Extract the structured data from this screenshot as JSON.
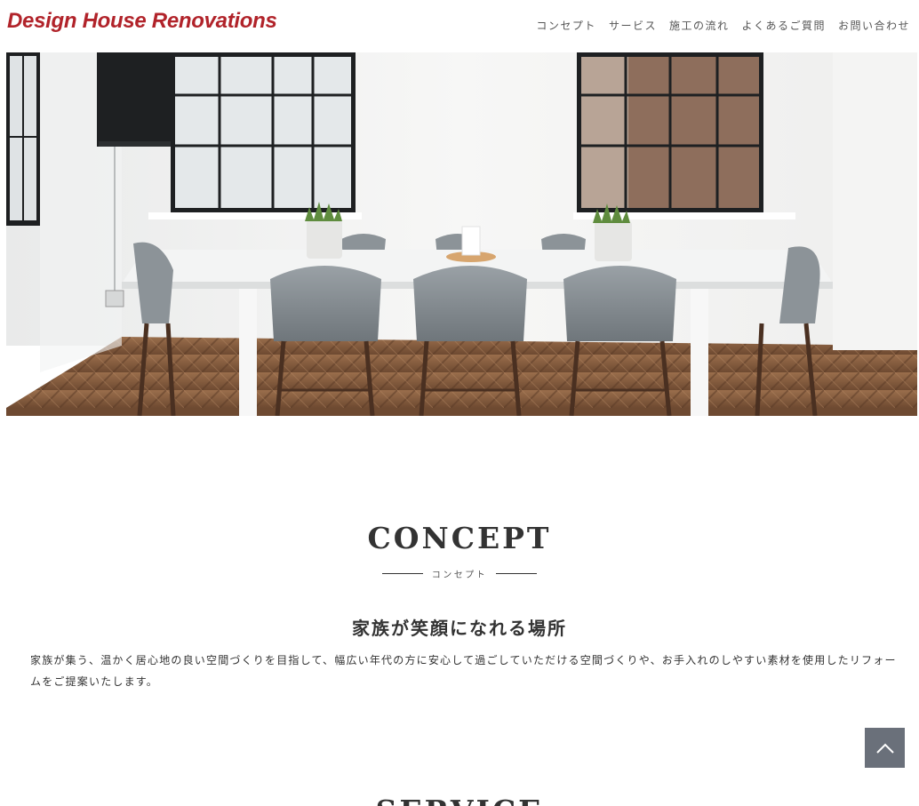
{
  "header": {
    "logo": "Design House Renovations",
    "nav": [
      "コンセプト",
      "サービス",
      "施工の流れ",
      "よくあるご質問",
      "お問い合わせ"
    ]
  },
  "hero": {
    "description": ""
  },
  "concept": {
    "title": "CONCEPT",
    "subtitle": "コンセプト",
    "heading": "家族が笑顔になれる場所",
    "body": "家族が集う、温かく居心地の良い空間づくりを目指して、幅広い年代の方に安心して過ごしていただける空間づくりや、お手入れのしやすい素材を使用したリフォームをご提案いたします。"
  },
  "next_section": {
    "title": "SERVICE"
  },
  "colors": {
    "brand": "#b1232a",
    "text": "#333333",
    "totop_bg": "#6a707a"
  },
  "icons": {
    "totop": "chevron-up-icon"
  }
}
